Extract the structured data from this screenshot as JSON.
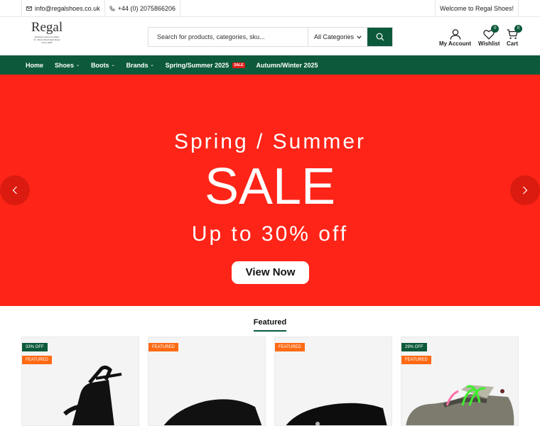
{
  "topbar": {
    "email": "info@regalshoes.co.uk",
    "phone": "+44 (0) 2075866206",
    "welcome": "Welcome to Regal Shoes!"
  },
  "logo": {
    "wordmark": "Regal",
    "line1": "Exclusive shoes for ladies",
    "line2": "St. Johns Wood High Street",
    "line3": "since 1953"
  },
  "search": {
    "placeholder": "Search for products, categories, sku...",
    "category": "All Categories"
  },
  "account": {
    "my_account": "My Account",
    "wishlist": "Wishlist",
    "wishlist_count": "0",
    "cart": "Cart",
    "cart_count": "0"
  },
  "nav": {
    "items": [
      {
        "label": "Home"
      },
      {
        "label": "Shoes"
      },
      {
        "label": "Boots"
      },
      {
        "label": "Brands"
      },
      {
        "label": "Spring/Summer 2025",
        "badge": "SALE"
      },
      {
        "label": "Autumn/Winter 2025"
      }
    ]
  },
  "hero": {
    "line1": "Spring / Summer",
    "line2": "SALE",
    "line3": "Up to 30% off",
    "cta": "View Now"
  },
  "featured": {
    "title": "Featured",
    "products": [
      {
        "discount": "33% OFF",
        "tag": "FEATURED"
      },
      {
        "tag": "FEATURED"
      },
      {
        "tag": "FEATURED"
      },
      {
        "discount": "29% OFF",
        "tag": "FEATURED"
      }
    ]
  },
  "colors": {
    "brand_green": "#0c5a3b",
    "hero_red": "#ff2418",
    "featured_orange": "#ff6a14"
  }
}
